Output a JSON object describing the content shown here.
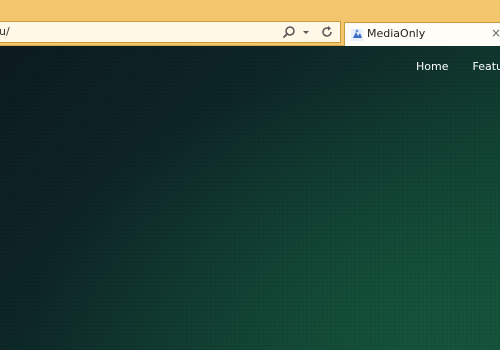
{
  "browser": {
    "address_text": "u/",
    "tab_title": "MediaOnly",
    "tab_close": "×",
    "icons": [
      "search-icon",
      "dropdown-arrow-icon",
      "refresh-icon",
      "favicon-icon",
      "close-icon"
    ]
  },
  "nav": {
    "items": [
      {
        "label": "Home"
      },
      {
        "label": "Featu"
      }
    ]
  },
  "colors": {
    "chrome_bg": "#f3c56c",
    "page_bg_dark": "#0b1a1c",
    "page_bg_green": "#114a33",
    "nav_text": "#ffffff"
  }
}
